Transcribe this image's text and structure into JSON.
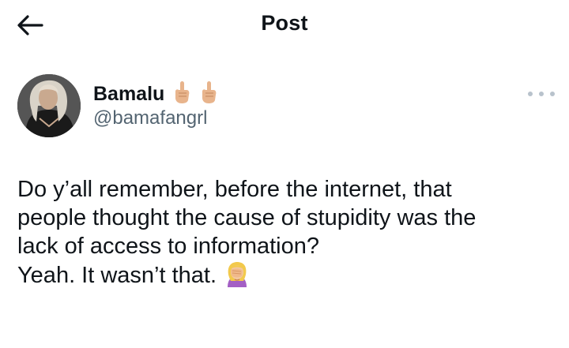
{
  "header": {
    "title": "Post",
    "back_icon": "arrow-left-icon"
  },
  "author": {
    "display_name": "Bamalu",
    "name_emojis": [
      "middle-finger-emoji",
      "middle-finger-emoji"
    ],
    "handle": "@bamafangrl",
    "avatar": "profile-photo"
  },
  "menu": {
    "icon": "more-horizontal-icon"
  },
  "tweet": {
    "lines": [
      "Do y’all remember, before the internet, that",
      "people thought the cause of stupidity was the",
      "lack of access to information?",
      "Yeah.  It wasn’t that."
    ],
    "trailing_emoji": "woman-facepalming-emoji"
  },
  "colors": {
    "text_primary": "#0f1419",
    "text_secondary": "#536471",
    "more_dots": "#b8c2cc",
    "background": "#ffffff"
  }
}
